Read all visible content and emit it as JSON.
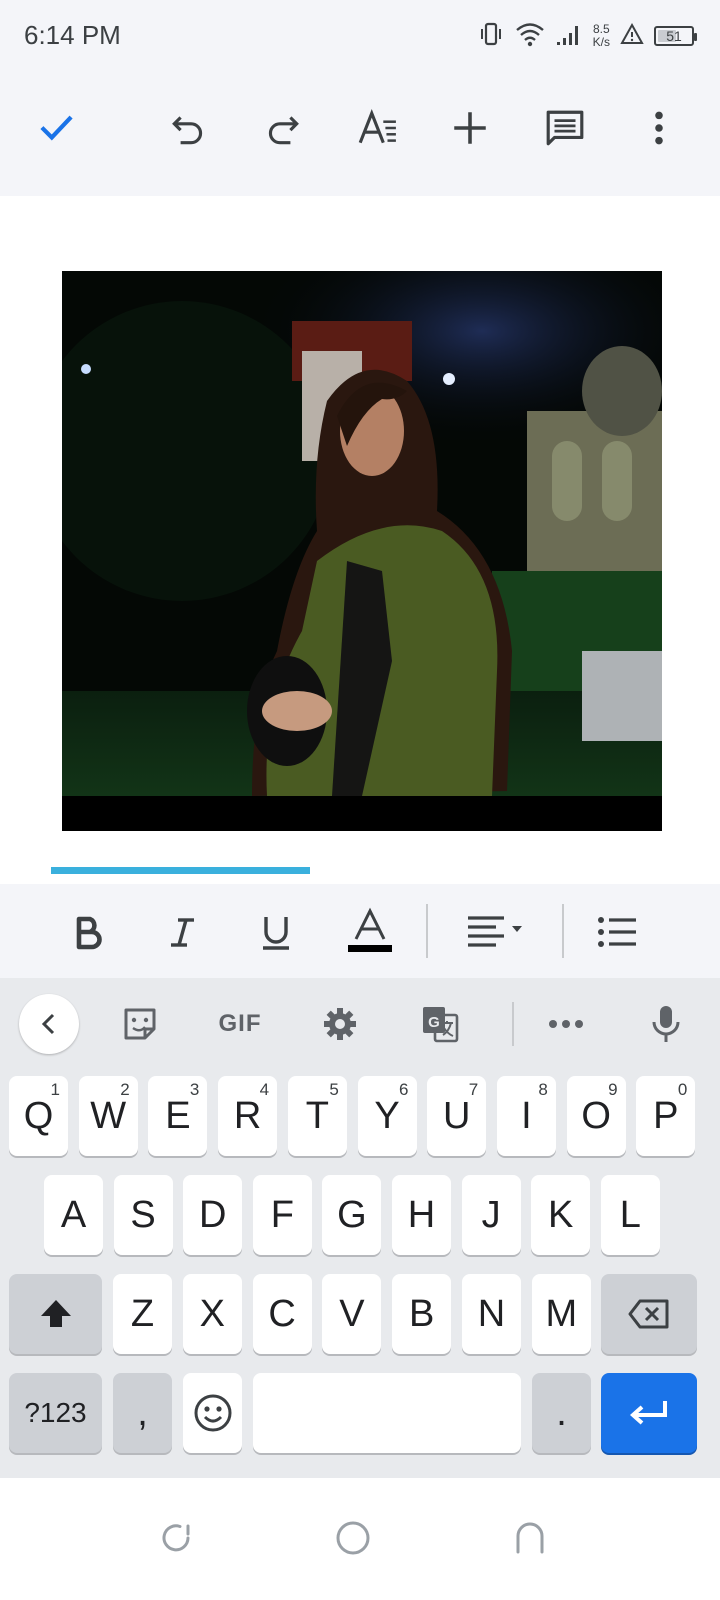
{
  "status_bar": {
    "time": "6:14 PM",
    "net_speed_value": "8.5",
    "net_speed_unit": "K/s",
    "battery_level": "51",
    "icons": [
      "vibrate-icon",
      "wifi-icon",
      "signal-icon",
      "alert-icon",
      "battery-icon"
    ]
  },
  "toolbar": {
    "icons": [
      "check-icon",
      "undo-icon",
      "redo-icon",
      "text-format-icon",
      "insert-icon",
      "comment-icon",
      "more-vertical-icon"
    ],
    "accent_color": "#1a73e8"
  },
  "document": {
    "image_description_icon": "inserted-photo",
    "progress": 0.36,
    "progress_color": "#3ab0dd"
  },
  "format_bar": {
    "icons": [
      "bold-icon",
      "italic-icon",
      "underline-icon",
      "text-color-icon",
      "align-icon",
      "bulleted-list-icon"
    ]
  },
  "keyboard_toolbar": {
    "gif_label": "GIF",
    "icons": [
      "back-icon",
      "sticker-icon",
      "gif-icon",
      "settings-icon",
      "translate-icon",
      "more-horizontal-icon",
      "mic-icon"
    ]
  },
  "keyboard": {
    "row1": [
      {
        "k": "Q",
        "h": "1"
      },
      {
        "k": "W",
        "h": "2"
      },
      {
        "k": "E",
        "h": "3"
      },
      {
        "k": "R",
        "h": "4"
      },
      {
        "k": "T",
        "h": "5"
      },
      {
        "k": "Y",
        "h": "6"
      },
      {
        "k": "U",
        "h": "7"
      },
      {
        "k": "I",
        "h": "8"
      },
      {
        "k": "O",
        "h": "9"
      },
      {
        "k": "P",
        "h": "0"
      }
    ],
    "row2": [
      "A",
      "S",
      "D",
      "F",
      "G",
      "H",
      "J",
      "K",
      "L"
    ],
    "row3": [
      "Z",
      "X",
      "C",
      "V",
      "B",
      "N",
      "M"
    ],
    "sym_label": "?123",
    "comma_label": ",",
    "period_label": ".",
    "enter_color": "#1a73e8"
  },
  "nav_bar": {
    "icons": [
      "recents-icon",
      "home-icon",
      "back-nav-icon"
    ]
  }
}
